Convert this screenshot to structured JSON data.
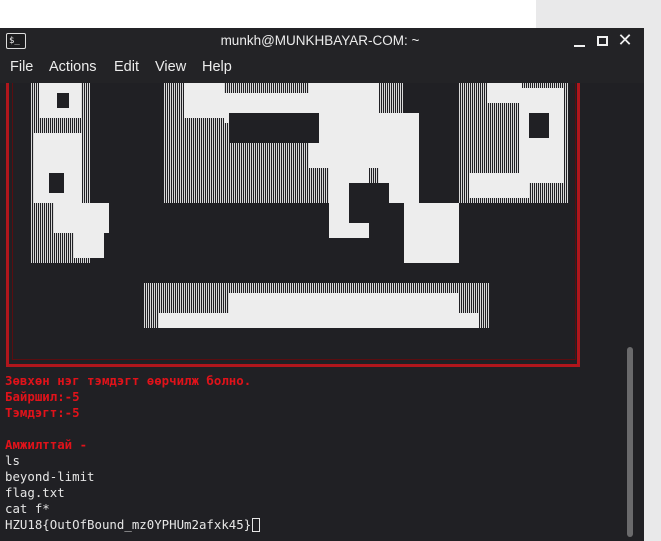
{
  "window": {
    "title": "munkh@MUNKHBAYAR-COM: ~",
    "icon": "terminal-icon",
    "controls": [
      "minimize-icon",
      "maximize-icon",
      "close-icon"
    ]
  },
  "menu": {
    "file": "File",
    "actions": "Actions",
    "edit": "Edit",
    "view": "View",
    "help": "Help"
  },
  "terminal": {
    "message": "Зөвхөн нэг тэмдэгт өөрчилж болно.",
    "position_line": "Байршил:-5",
    "char_line": "Тэмдэгт:-5",
    "success": "Амжилттай -",
    "cmd1": "ls",
    "out1": "beyond-limit",
    "out2": "flag.txt",
    "cmd2": "cat f*",
    "flag": "HZU18{OutOfBound_mz0YPHUm2afxk45}"
  },
  "colors": {
    "terminal_bg": "#202024",
    "accent_red": "#e0121a",
    "text": "#e6e6e6"
  }
}
